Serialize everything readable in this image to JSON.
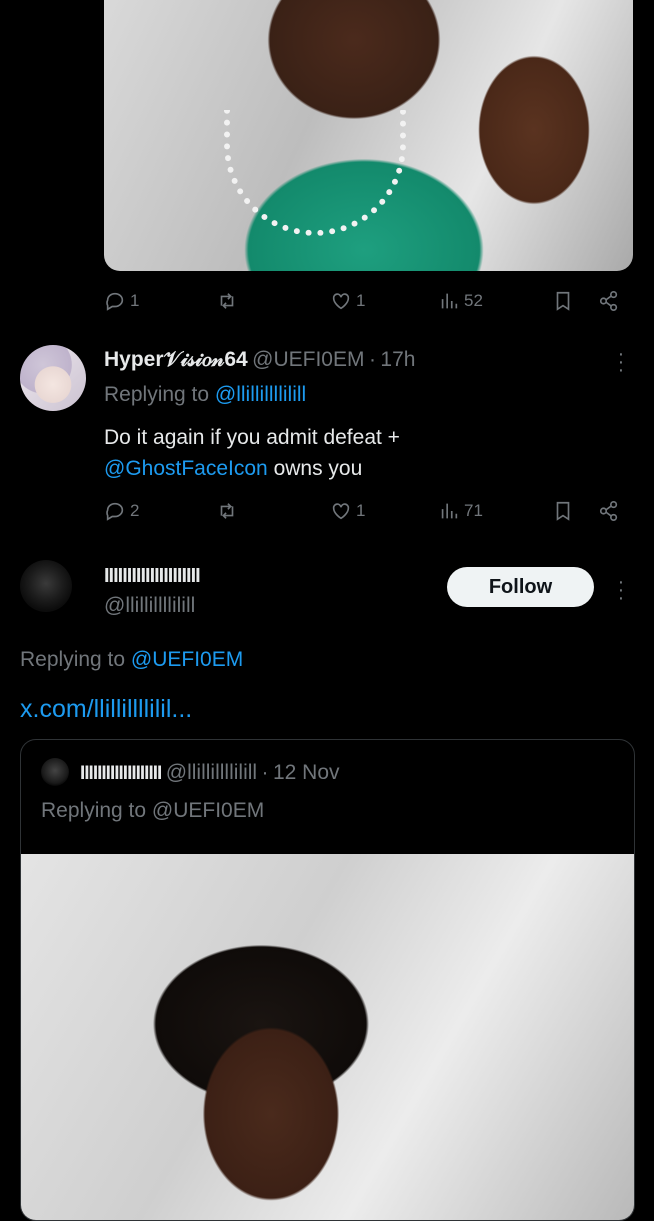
{
  "top_tweet": {
    "actions": {
      "replies": "1",
      "retweets": "",
      "likes": "1",
      "views": "52"
    }
  },
  "reply": {
    "display_name": "Hyper𝒱𝒾𝓈𝒾𝑜𝓃64",
    "handle": "@UEFI0EM",
    "separator": "·",
    "time": "17h",
    "replying_prefix": "Replying to",
    "replying_to": "@llillillllilill",
    "text_line1": "Do it again if you admit defeat +",
    "mention": "@GhostFaceIcon",
    "text_line2_rest": " owns you",
    "actions": {
      "replies": "2",
      "retweets": "",
      "likes": "1",
      "views": "71"
    }
  },
  "profile": {
    "display_name": "IIIIIIIIIIIIIIIIIIIII",
    "handle": "@llillillllilill",
    "follow_label": "Follow",
    "replying_prefix": "Replying to",
    "replying_to": "@UEFI0EM",
    "link": "x.com/llillillllilil..."
  },
  "quote": {
    "display_name": "IIIIIIIIIIIIIIIIIII",
    "handle": "@llillillllilill",
    "separator": "·",
    "date": "12 Nov",
    "replying_prefix": "Replying to",
    "replying_to": "@UEFI0EM"
  },
  "colors": {
    "background": "#000000",
    "text": "#e7e9ea",
    "muted": "#71767b",
    "link": "#1d9bf0",
    "button": "#eff3f4"
  },
  "icons": [
    "reply-icon",
    "retweet-icon",
    "like-icon",
    "views-icon",
    "bookmark-icon",
    "share-icon",
    "more-icon"
  ]
}
